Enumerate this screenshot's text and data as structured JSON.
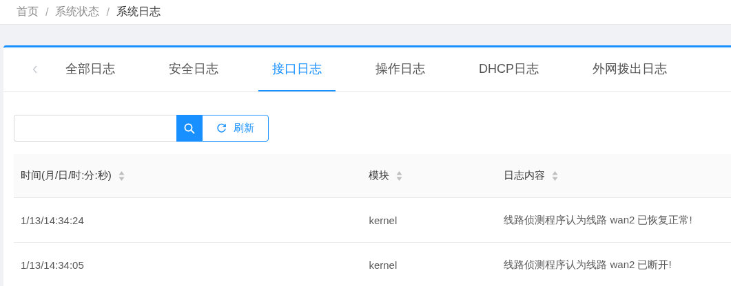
{
  "breadcrumb": {
    "separator": "/",
    "items": [
      {
        "label": "首页"
      },
      {
        "label": "系统状态"
      },
      {
        "label": "系统日志"
      }
    ]
  },
  "tabs": [
    {
      "label": "全部日志",
      "selected": false
    },
    {
      "label": "安全日志",
      "selected": false
    },
    {
      "label": "接口日志",
      "selected": true
    },
    {
      "label": "操作日志",
      "selected": false
    },
    {
      "label": "DHCP日志",
      "selected": false
    },
    {
      "label": "外网拨出日志",
      "selected": false
    }
  ],
  "toolbar": {
    "refresh_label": "刷新"
  },
  "table": {
    "columns": [
      {
        "label": "时间(月/日/时:分:秒)"
      },
      {
        "label": "模块"
      },
      {
        "label": "日志内容"
      }
    ],
    "rows": [
      {
        "cells": [
          "1/13/14:34:24",
          "kernel",
          "线路侦测程序认为线路 wan2 已恢复正常!"
        ]
      },
      {
        "cells": [
          "1/13/14:34:05",
          "kernel",
          "线路侦测程序认为线路 wan2 已断开!"
        ]
      }
    ]
  }
}
